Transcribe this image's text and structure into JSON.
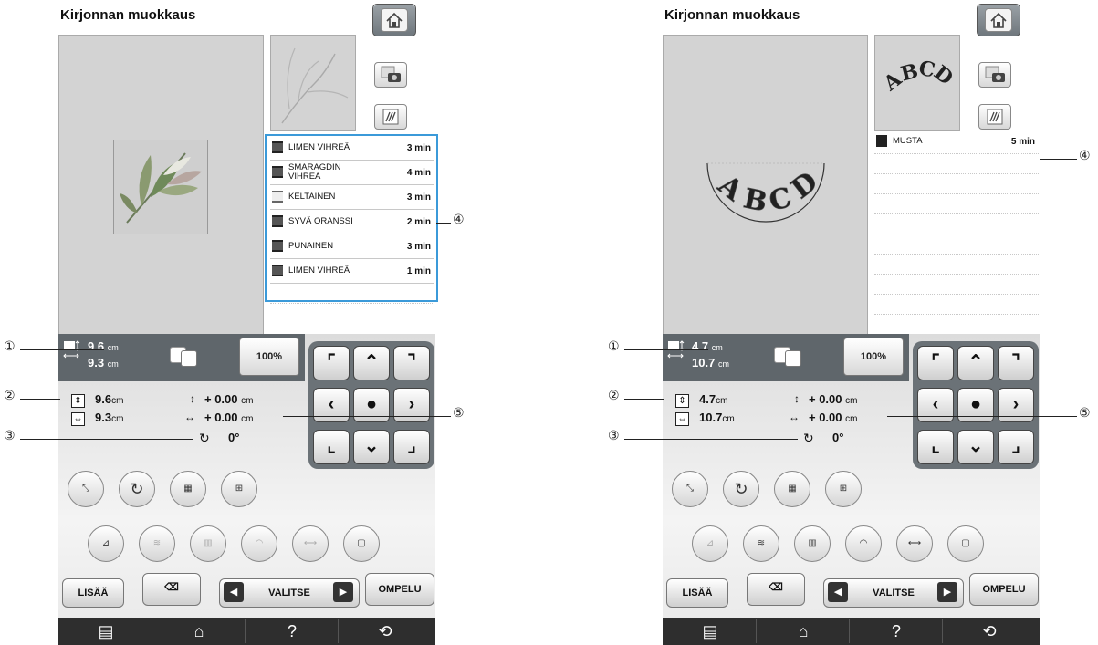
{
  "screens": [
    {
      "title": "Kirjonnan muokkaus",
      "size": {
        "height": "9.6",
        "width": "9.3",
        "unit": "cm"
      },
      "zoom": "100%",
      "dims": {
        "height": "9.6",
        "width": "9.3",
        "unit": "cm",
        "v_offset": "+ 0.00",
        "h_offset": "+ 0.00",
        "offset_unit": "cm",
        "rotation": "0°"
      },
      "threads": [
        {
          "name": "LIMEN VIHREÄ",
          "time": "3 min",
          "shade": "mid"
        },
        {
          "name": "SMARAGDIN\nVIHREÄ",
          "time": "4 min",
          "shade": "mid"
        },
        {
          "name": "KELTAINEN",
          "time": "3 min",
          "shade": "light"
        },
        {
          "name": "SYVÄ ORANSSI",
          "time": "2 min",
          "shade": "mid"
        },
        {
          "name": "PUNAINEN",
          "time": "3 min",
          "shade": "mid"
        },
        {
          "name": "LIMEN VIHREÄ",
          "time": "1 min",
          "shade": "mid"
        }
      ],
      "buttons": {
        "lisaa": "LISÄÄ",
        "valitse": "VALITSE",
        "ompelu": "OMPELU"
      },
      "callouts": [
        "①",
        "②",
        "③",
        "④",
        "⑤"
      ]
    },
    {
      "title": "Kirjonnan muokkaus",
      "size": {
        "height": "4.7",
        "width": "10.7",
        "unit": "cm"
      },
      "zoom": "100%",
      "dims": {
        "height": "4.7",
        "width": "10.7",
        "unit": "cm",
        "v_offset": "+ 0.00",
        "h_offset": "+ 0.00",
        "offset_unit": "cm",
        "rotation": "0°"
      },
      "threads": [
        {
          "name": "MUSTA",
          "time": "5 min",
          "shade": "dark"
        }
      ],
      "preview_text": "ABCD",
      "buttons": {
        "lisaa": "LISÄÄ",
        "valitse": "VALITSE",
        "ompelu": "OMPELU"
      },
      "callouts": [
        "①",
        "②",
        "③",
        "④",
        "⑤"
      ]
    }
  ],
  "bottom_bar": {
    "help": "?"
  },
  "colors": {
    "accent_frame": "#3b9ad9",
    "bar": "#5f666b",
    "dpad": "#6b7277"
  }
}
